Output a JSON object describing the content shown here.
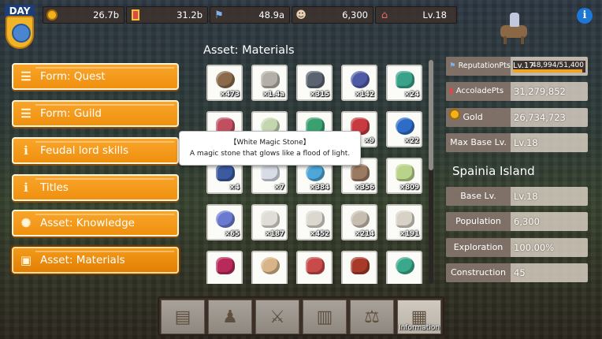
{
  "top_bar": {
    "day_label": "DAY",
    "resources": [
      {
        "icon": "gold-coin-icon",
        "value": "26.7b"
      },
      {
        "icon": "accolade-medal-icon",
        "value": "31.2b"
      },
      {
        "icon": "reputation-flag-icon",
        "value": "48.9a"
      },
      {
        "icon": "population-person-icon",
        "value": "6,300"
      },
      {
        "icon": "house-icon",
        "value": "Lv.18"
      }
    ],
    "info_symbol": "i"
  },
  "menu": [
    {
      "label": "Form: Quest",
      "icon": "scroll-icon"
    },
    {
      "label": "Form: Guild",
      "icon": "scroll-icon"
    },
    {
      "label": "Feudal lord skills",
      "icon": "info-icon",
      "symbol": "i"
    },
    {
      "label": "Titles",
      "icon": "info-icon",
      "symbol": "i"
    },
    {
      "label": "Asset: Knowledge",
      "icon": "knowledge-icon"
    },
    {
      "label": "Asset: Materials",
      "icon": "box-icon",
      "selected": true
    }
  ],
  "materials": {
    "title": "Asset: Materials",
    "items": [
      {
        "count": "×473",
        "color": "#8a6a4a",
        "name": "logs-icon"
      },
      {
        "count": "×1.4a",
        "color": "#b4b0a8",
        "name": "stone-icon"
      },
      {
        "count": "×315",
        "color": "#5b6270",
        "name": "iron-ore-icon"
      },
      {
        "count": "×142",
        "color": "#4f5aa6",
        "name": "blue-ore-icon"
      },
      {
        "count": "×24",
        "color": "#3aa28a",
        "name": "green-ore-icon"
      },
      {
        "count": "",
        "color": "#c05060",
        "name": "red-gem-icon"
      },
      {
        "count": "",
        "color": "#c4d6b0",
        "name": "white-magic-stone-icon"
      },
      {
        "count": "",
        "color": "#3aa070",
        "name": "green-gem-icon"
      },
      {
        "count": "×9",
        "color": "#c83a40",
        "name": "ruby-icon"
      },
      {
        "count": "×22",
        "color": "#2f6cc8",
        "name": "sapphire-icon"
      },
      {
        "count": "×4",
        "color": "#3b5aa0",
        "name": "dark-crystal-icon"
      },
      {
        "count": "×7",
        "color": "#d8dce6",
        "name": "heart-crystal-icon"
      },
      {
        "count": "×384",
        "color": "#4fa6d8",
        "name": "potion-icon"
      },
      {
        "count": "×356",
        "color": "#9b7a62",
        "name": "hide-icon"
      },
      {
        "count": "×809",
        "color": "#b9d48a",
        "name": "leaf-icon"
      },
      {
        "count": "×65",
        "color": "#6b7ad0",
        "name": "feather-icon"
      },
      {
        "count": "×187",
        "color": "#e0ddd6",
        "name": "bone-icon"
      },
      {
        "count": "×452",
        "color": "#dcd8cf",
        "name": "rope-icon"
      },
      {
        "count": "×214",
        "color": "#c8beb0",
        "name": "shell-icon"
      },
      {
        "count": "×191",
        "color": "#d8d2c6",
        "name": "skull-icon"
      },
      {
        "count": "",
        "color": "#b82a5a",
        "name": "red-tentacle-icon"
      },
      {
        "count": "",
        "color": "#d8b488",
        "name": "eye-orb-icon"
      },
      {
        "count": "",
        "color": "#c84a4a",
        "name": "red-mushroom-icon"
      },
      {
        "count": "",
        "color": "#a83a2a",
        "name": "red-feather-icon"
      },
      {
        "count": "",
        "color": "#3aa88a",
        "name": "green-slime-icon"
      }
    ]
  },
  "tooltip": {
    "title": "【White Magic Stone】",
    "description": "A magic stone that glows like a flood of light."
  },
  "stats": {
    "reputation_label": "ReputationPts",
    "reputation_level": "Lv.17",
    "reputation_progress": "48,994/51,400",
    "reputation_fraction": 0.953,
    "accolade_label": "AccoladePts",
    "accolade_value": "31,279,852",
    "gold_label": "Gold",
    "gold_value": "26,734,723",
    "max_base_label": "Max Base Lv.",
    "max_base_value": "Lv.18"
  },
  "island": {
    "name": "Spainia Island",
    "rows": [
      {
        "label": "Base Lv.",
        "value": "Lv.18"
      },
      {
        "label": "Population",
        "value": "6,300"
      },
      {
        "label": "Exploration",
        "value": "100.00%"
      },
      {
        "label": "Construction",
        "value": "45"
      }
    ]
  },
  "bottom_nav": [
    {
      "name": "map-button",
      "glyph": "▤",
      "label": ""
    },
    {
      "name": "residents-button",
      "glyph": "♟",
      "label": ""
    },
    {
      "name": "battle-button",
      "glyph": "⚔",
      "label": ""
    },
    {
      "name": "board-button",
      "glyph": "▥",
      "label": ""
    },
    {
      "name": "trade-button",
      "glyph": "⚖",
      "label": ""
    },
    {
      "name": "information-button",
      "glyph": "▦",
      "label": "Information",
      "active": true
    }
  ]
}
